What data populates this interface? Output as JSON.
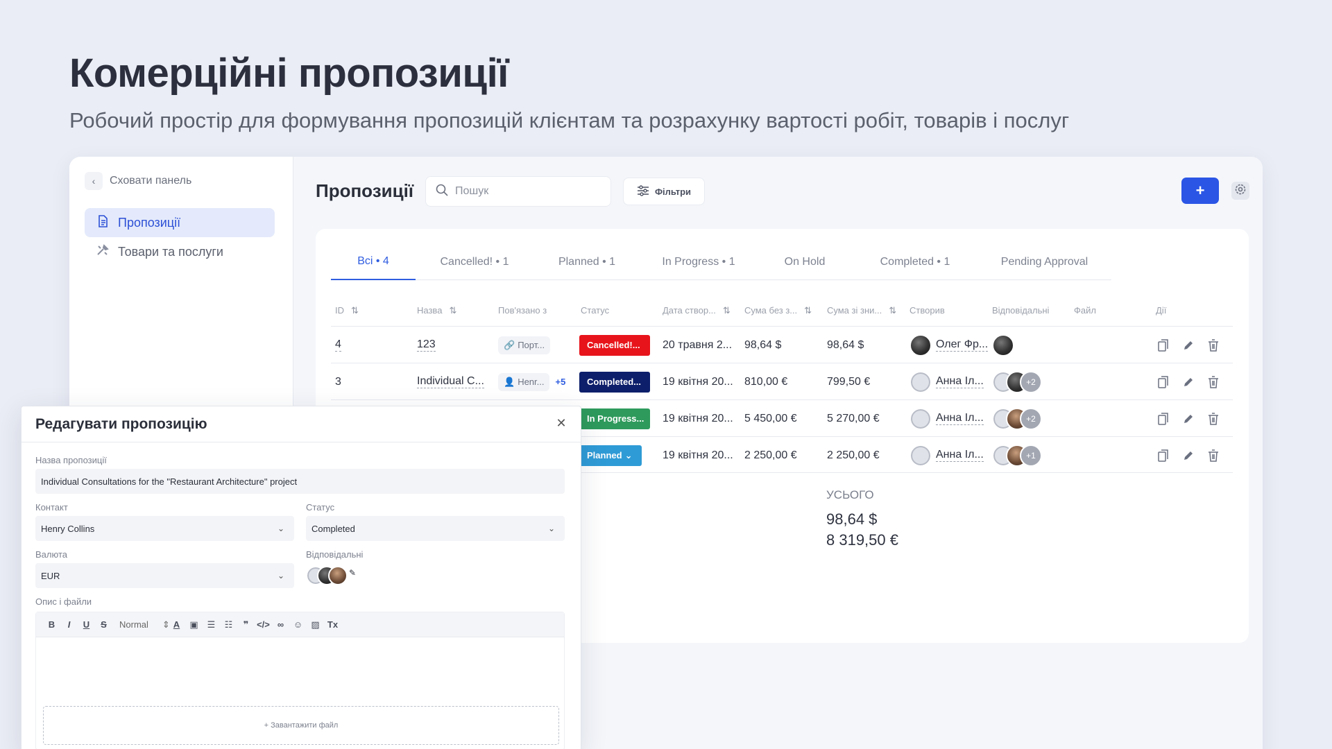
{
  "hero": {
    "title": "Комерційні пропозиції",
    "subtitle": "Робочий простір для формування пропозицій клієнтам та розрахунку вартості робіт, товарів і послуг"
  },
  "sidebar": {
    "hide_label": "Сховати панель",
    "items": [
      {
        "label": "Пропозиції",
        "icon": "document-icon",
        "active": true
      },
      {
        "label": "Товари та послуги",
        "icon": "tools-icon",
        "active": false
      }
    ]
  },
  "header": {
    "title": "Пропозиції",
    "search_placeholder": "Пошук",
    "filters_label": "Фільтри",
    "add_label": "+"
  },
  "tabs": [
    {
      "label": "Всі • 4",
      "active": true
    },
    {
      "label": "Cancelled! • 1",
      "active": false
    },
    {
      "label": "Planned • 1",
      "active": false
    },
    {
      "label": "In Progress • 1",
      "active": false
    },
    {
      "label": "On Hold",
      "active": false
    },
    {
      "label": "Completed • 1",
      "active": false
    },
    {
      "label": "Pending Approval",
      "active": false
    }
  ],
  "table": {
    "columns": [
      "ID",
      "Назва",
      "Пов'язано з",
      "Статус",
      "Дата створ...",
      "Сума без з...",
      "Сума зі зни...",
      "Створив",
      "Відповідальні",
      "Файл",
      "Дії"
    ],
    "rows": [
      {
        "id": "4",
        "name": "123",
        "linked": "Порт...",
        "linked_extra": "",
        "status": "Cancelled!...",
        "status_color": "#e8141b",
        "date": "20 травня 2...",
        "sum_no_disc": "98,64 $",
        "sum_disc": "98,64 $",
        "creator": "Олег Фр...",
        "resp_more": ""
      },
      {
        "id": "3",
        "name": "Individual C...",
        "linked": "Henr...",
        "linked_extra": "+5",
        "status": "Completed...",
        "status_color": "#0d1f6b",
        "date": "19 квітня 20...",
        "sum_no_disc": "810,00 €",
        "sum_disc": "799,50 €",
        "creator": "Анна Іл...",
        "resp_more": "+2"
      },
      {
        "id": "",
        "name": "",
        "linked": "",
        "linked_extra": "",
        "status": "In Progress...",
        "status_color": "#2e9a5c",
        "date": "19 квітня 20...",
        "sum_no_disc": "5 450,00 €",
        "sum_disc": "5 270,00 €",
        "creator": "Анна Іл...",
        "resp_more": "+2"
      },
      {
        "id": "",
        "name": "",
        "linked": "",
        "linked_extra": "",
        "status": "Planned",
        "status_color": "#2f9bd6",
        "date": "19 квітня 20...",
        "sum_no_disc": "2 250,00 €",
        "sum_disc": "2 250,00 €",
        "creator": "Анна Іл...",
        "resp_more": "+1"
      }
    ],
    "total_label": "УСЬОГО",
    "totals": [
      "98,64 $",
      "8 319,50 €"
    ]
  },
  "modal": {
    "title": "Редагувати пропозицію",
    "name_label": "Назва пропозиції",
    "name_value": "Individual Consultations for the \"Restaurant Architecture\" project",
    "contact_label": "Контакт",
    "contact_value": "Henry Collins",
    "status_label": "Статус",
    "status_value": "Completed",
    "currency_label": "Валюта",
    "currency_value": "EUR",
    "responsible_label": "Відповідальні",
    "desc_label": "Опис і файли",
    "format_value": "Normal",
    "upload_label": "+ Завантажити файл"
  },
  "colors": {
    "accent": "#2a55e5",
    "cancelled": "#e8141b",
    "completed": "#0d1f6b",
    "in_progress": "#2e9a5c",
    "planned": "#2f9bd6"
  }
}
